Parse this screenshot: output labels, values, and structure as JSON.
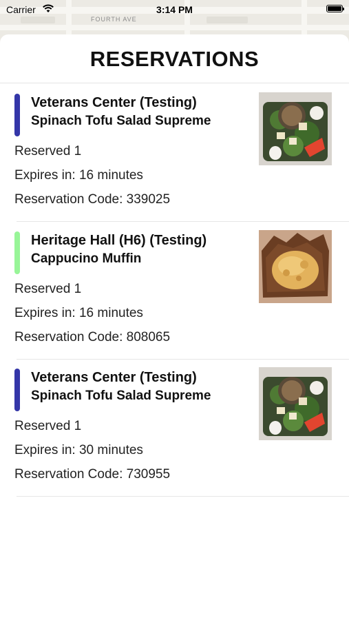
{
  "status_bar": {
    "carrier": "Carrier",
    "time": "3:14 PM"
  },
  "map": {
    "street_label": "FOURTH AVE"
  },
  "sheet": {
    "title": "RESERVATIONS"
  },
  "reservations": [
    {
      "location": "Veterans Center (Testing)",
      "item": "Spinach Tofu Salad Supreme",
      "reserved": "Reserved 1",
      "expires": "Expires in: 16 minutes",
      "code": "Reservation Code: 339025",
      "accent_color": "#3436a8",
      "image": "salad-image"
    },
    {
      "location": "Heritage Hall (H6) (Testing)",
      "item": "Cappucino Muffin",
      "reserved": "Reserved 1",
      "expires": "Expires in: 16 minutes",
      "code": "Reservation Code: 808065",
      "accent_color": "#98f598",
      "image": "muffin-image"
    },
    {
      "location": "Veterans Center (Testing)",
      "item": "Spinach Tofu Salad Supreme",
      "reserved": "Reserved 1",
      "expires": "Expires in: 30 minutes",
      "code": "Reservation Code: 730955",
      "accent_color": "#3436a8",
      "image": "salad-image"
    }
  ]
}
